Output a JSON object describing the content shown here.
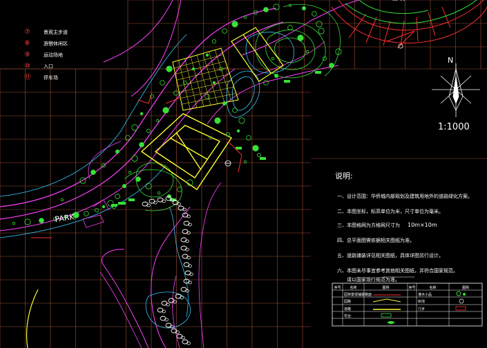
{
  "legend_left": [
    {
      "num": "⑦",
      "text": "景观主步道"
    },
    {
      "num": "⑧",
      "text": "游憩休闲区"
    },
    {
      "num": "⑨",
      "text": "运动场地"
    },
    {
      "num": "⑩",
      "text": "入口"
    },
    {
      "num": "⑪",
      "text": "停车场"
    }
  ],
  "scale_text": "1:1000",
  "north_label": "N",
  "park_label": "PARK",
  "notes": {
    "title": "说明:",
    "items": [
      "一、设计范围：华侨城内部规划及建筑用地外的道路绿化方案。",
      "二、本图坐标，标高单位为米，尺寸单位为毫米。",
      "三、本图格网为方格网尺寸为",
      "四、总平面图需依据相关图纸为准。",
      "五、道路铺装详见相关图纸，具体详图另行设计。",
      "六、本图未尽事宜参考其他相关图纸，并符合国家规范。"
    ],
    "grid_size": "10m×10m",
    "extra_line": "请以国家现行规范为准。"
  },
  "legend_table": {
    "title": "图 例",
    "header": [
      "序号",
      "名称",
      "图例",
      "序号",
      "名称",
      "图例"
    ],
    "rows": [
      {
        "left": "园林景观铺装路面",
        "right": "灌木小品"
      },
      {
        "left": "园路",
        "right": "树池"
      },
      {
        "left": "道路",
        "right": "汀步"
      },
      {
        "left": "花台",
        "right": ""
      },
      {
        "left": "",
        "right": ""
      }
    ]
  },
  "colors": {
    "grid": "#a0503a",
    "road_magenta": "#ff40ff",
    "plaza_yellow": "#ffff30",
    "tree_green": "#38e038",
    "water_cyan": "#39c8ff",
    "white_path": "#ffffff",
    "red_paving": "#ff3030"
  }
}
